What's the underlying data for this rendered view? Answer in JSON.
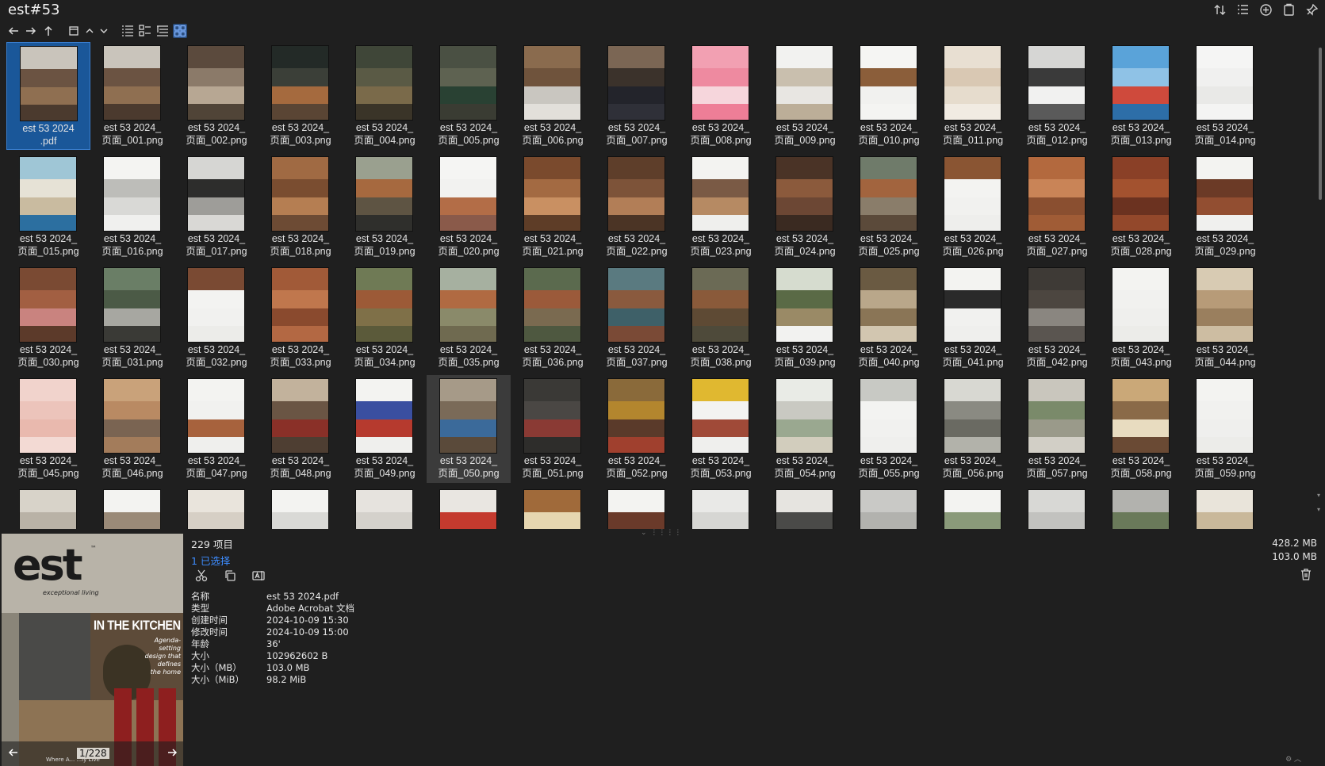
{
  "window": {
    "title": "est#53"
  },
  "toolbar": {
    "back": "back-arrow-icon",
    "forward": "forward-arrow-icon",
    "up": "up-arrow-icon",
    "view_modes": [
      "details-view-icon",
      "list-view-icon",
      "tree-view-icon",
      "grid-view-icon"
    ]
  },
  "files": [
    {
      "name": "est 53 2024\n.pdf",
      "colors": [
        "#c9c4bb",
        "#6b5342",
        "#8f6f51",
        "#4b3a2e"
      ]
    },
    {
      "name": "est 53 2024_\n页面_001.png",
      "colors": [
        "#c9c4bb",
        "#6b5342",
        "#8f6f51",
        "#4b3a2e"
      ]
    },
    {
      "name": "est 53 2024_\n页面_002.png",
      "colors": [
        "#5b4a3d",
        "#8b7a69",
        "#b7a793",
        "#504437"
      ]
    },
    {
      "name": "est 53 2024_\n页面_003.png",
      "colors": [
        "#232a27",
        "#3b3f38",
        "#a56a3e",
        "#5a4534"
      ]
    },
    {
      "name": "est 53 2024_\n页面_004.png",
      "colors": [
        "#3f4638",
        "#5a5a45",
        "#7a6a4a",
        "#3a3428"
      ]
    },
    {
      "name": "est 53 2024_\n页面_005.png",
      "colors": [
        "#4a5043",
        "#5e6251",
        "#294133",
        "#3a3c33"
      ]
    },
    {
      "name": "est 53 2024_\n页面_006.png",
      "colors": [
        "#8a6b4e",
        "#6f533c",
        "#c9c6c0",
        "#e2dfda"
      ]
    },
    {
      "name": "est 53 2024_\n页面_007.png",
      "colors": [
        "#7b6654",
        "#3b322b",
        "#23242b",
        "#2f3038"
      ]
    },
    {
      "name": "est 53 2024_\n页面_008.png",
      "colors": [
        "#f2a0b2",
        "#ee8aa0",
        "#f6d6dc",
        "#ee7e97"
      ]
    },
    {
      "name": "est 53 2024_\n页面_009.png",
      "colors": [
        "#f2f2f0",
        "#c9bfae",
        "#e8e6e2",
        "#bcae98"
      ]
    },
    {
      "name": "est 53 2024_\n页面_010.png",
      "colors": [
        "#f5f5f3",
        "#8b5e3a",
        "#f1f1ef",
        "#f4f4f2"
      ]
    },
    {
      "name": "est 53 2024_\n页面_011.png",
      "colors": [
        "#e8dfd2",
        "#d9c8b3",
        "#e6dccd",
        "#f1ebe2"
      ]
    },
    {
      "name": "est 53 2024_\n页面_012.png",
      "colors": [
        "#d6d6d4",
        "#3a3a3a",
        "#f1f1f0",
        "#5a5a5a"
      ]
    },
    {
      "name": "est 53 2024_\n页面_013.png",
      "colors": [
        "#5aa3d9",
        "#8fc2e6",
        "#cf4a3c",
        "#2d6ea8"
      ]
    },
    {
      "name": "est 53 2024_\n页面_014.png",
      "colors": [
        "#f5f5f4",
        "#f0f0ef",
        "#e9e9e7",
        "#f4f4f3"
      ]
    },
    {
      "name": "est 53 2024_\n页面_015.png",
      "colors": [
        "#9fc6d6",
        "#e6e2d6",
        "#c9bba0",
        "#2c6fa0"
      ]
    },
    {
      "name": "est 53 2024_\n页面_016.png",
      "colors": [
        "#f4f4f2",
        "#bdbdb9",
        "#d9d9d6",
        "#f0f0ee"
      ]
    },
    {
      "name": "est 53 2024_\n页面_017.png",
      "colors": [
        "#d6d6d3",
        "#2d2d2c",
        "#9e9d99",
        "#d9d8d5"
      ]
    },
    {
      "name": "est 53 2024_\n页面_018.png",
      "colors": [
        "#a06a43",
        "#7a4d30",
        "#b57e52",
        "#6d4b34"
      ]
    },
    {
      "name": "est 53 2024_\n页面_019.png",
      "colors": [
        "#9aa08f",
        "#a6693f",
        "#5e5443",
        "#2f2f2c"
      ]
    },
    {
      "name": "est 53 2024_\n页面_020.png",
      "colors": [
        "#f5f5f3",
        "#f2f2f0",
        "#b36d47",
        "#8a5a4a"
      ]
    },
    {
      "name": "est 53 2024_\n页面_021.png",
      "colors": [
        "#7a4a2d",
        "#a36a42",
        "#c99062",
        "#5e3d27"
      ]
    },
    {
      "name": "est 53 2024_\n页面_022.png",
      "colors": [
        "#5e3e2a",
        "#7d5339",
        "#b27e57",
        "#4b3425"
      ]
    },
    {
      "name": "est 53 2024_\n页面_023.png",
      "colors": [
        "#f3f3f1",
        "#7a5a45",
        "#b68a63",
        "#efefed"
      ]
    },
    {
      "name": "est 53 2024_\n页面_024.png",
      "colors": [
        "#4a3326",
        "#8b5a3c",
        "#6c4734",
        "#3a2a21"
      ]
    },
    {
      "name": "est 53 2024_\n页面_025.png",
      "colors": [
        "#6f7b6a",
        "#a2643e",
        "#8a7d6a",
        "#5b4a3a"
      ]
    },
    {
      "name": "est 53 2024_\n页面_026.png",
      "colors": [
        "#8a5533",
        "#f3f3f1",
        "#f1f1ef",
        "#eeeeec"
      ]
    },
    {
      "name": "est 53 2024_\n页面_027.png",
      "colors": [
        "#b3693e",
        "#c98457",
        "#8a4f30",
        "#a05c36"
      ]
    },
    {
      "name": "est 53 2024_\n页面_028.png",
      "colors": [
        "#8a4027",
        "#a3522f",
        "#6b3220",
        "#93482b"
      ]
    },
    {
      "name": "est 53 2024_\n页面_029.png",
      "colors": [
        "#f3f3f1",
        "#6b3a26",
        "#924e31",
        "#f0f0ee"
      ]
    },
    {
      "name": "est 53 2024_\n页面_030.png",
      "colors": [
        "#7a4a33",
        "#a25f42",
        "#c9837f",
        "#5c3a2a"
      ]
    },
    {
      "name": "est 53 2024_\n页面_031.png",
      "colors": [
        "#6a7e66",
        "#4b5a46",
        "#a7a7a1",
        "#3a3a36"
      ]
    },
    {
      "name": "est 53 2024_\n页面_032.png",
      "colors": [
        "#7a4a33",
        "#f3f3f1",
        "#f1f1ef",
        "#ecece9"
      ]
    },
    {
      "name": "est 53 2024_\n页面_033.png",
      "colors": [
        "#a15a38",
        "#c0774d",
        "#8a4a2e",
        "#b36843"
      ]
    },
    {
      "name": "est 53 2024_\n页面_034.png",
      "colors": [
        "#6f7a55",
        "#9c5a37",
        "#7f7048",
        "#5b5a3a"
      ]
    },
    {
      "name": "est 53 2024_\n页面_035.png",
      "colors": [
        "#a6b0a0",
        "#b06a42",
        "#8a8a6a",
        "#6f6a50"
      ]
    },
    {
      "name": "est 53 2024_\n页面_036.png",
      "colors": [
        "#5b6a4e",
        "#9b5a3a",
        "#7a6a50",
        "#4e5840"
      ]
    },
    {
      "name": "est 53 2024_\n页面_037.png",
      "colors": [
        "#5a7a80",
        "#8a5a3e",
        "#3e6068",
        "#7a4a36"
      ]
    },
    {
      "name": "est 53 2024_\n页面_038.png",
      "colors": [
        "#6b6a55",
        "#8a5a3a",
        "#5e4a34",
        "#4e4a3a"
      ]
    },
    {
      "name": "est 53 2024_\n页面_039.png",
      "colors": [
        "#d6dccf",
        "#5a6a46",
        "#9a8a66",
        "#f2f2f0"
      ]
    },
    {
      "name": "est 53 2024_\n页面_040.png",
      "colors": [
        "#6a5a42",
        "#b9a78a",
        "#8a7556",
        "#d2c6b0"
      ]
    },
    {
      "name": "est 53 2024_\n页面_041.png",
      "colors": [
        "#f3f3f1",
        "#2a2a2a",
        "#f1f1ef",
        "#efefed"
      ]
    },
    {
      "name": "est 53 2024_\n页面_042.png",
      "colors": [
        "#3e3a36",
        "#4c4640",
        "#8a8680",
        "#5a5550"
      ]
    },
    {
      "name": "est 53 2024_\n页面_043.png",
      "colors": [
        "#f3f3f1",
        "#f1f1ef",
        "#efefed",
        "#ecece9"
      ]
    },
    {
      "name": "est 53 2024_\n页面_044.png",
      "colors": [
        "#d8cbb3",
        "#b79b78",
        "#9a7f5e",
        "#cdbda2"
      ]
    },
    {
      "name": "est 53 2024_\n页面_045.png",
      "colors": [
        "#f1d3cc",
        "#ecc4bb",
        "#e9b9ae",
        "#f3dad4"
      ]
    },
    {
      "name": "est 53 2024_\n页面_046.png",
      "colors": [
        "#c9a27a",
        "#b98a63",
        "#7a6452",
        "#a37c5b"
      ]
    },
    {
      "name": "est 53 2024_\n页面_047.png",
      "colors": [
        "#f3f3f1",
        "#f1f1ef",
        "#a7623d",
        "#efefed"
      ]
    },
    {
      "name": "est 53 2024_\n页面_048.png",
      "colors": [
        "#c2b29c",
        "#6a5544",
        "#8a3028",
        "#4e3e32"
      ]
    },
    {
      "name": "est 53 2024_\n页面_049.png",
      "colors": [
        "#f3f3f1",
        "#3a4fa0",
        "#b63a2e",
        "#efefed"
      ]
    },
    {
      "name": "est 53 2024_\n页面_050.png",
      "colors": [
        "#a69a88",
        "#7a6a58",
        "#3b6a9a",
        "#5a4a3a"
      ]
    },
    {
      "name": "est 53 2024_\n页面_051.png",
      "colors": [
        "#3a3936",
        "#4a4744",
        "#8a3a34",
        "#2e2d2b"
      ]
    },
    {
      "name": "est 53 2024_\n页面_052.png",
      "colors": [
        "#8a6a3a",
        "#b3862e",
        "#5a3a2a",
        "#a0402e"
      ]
    },
    {
      "name": "est 53 2024_\n页面_053.png",
      "colors": [
        "#e0b830",
        "#f3f3f1",
        "#a04a38",
        "#efefed"
      ]
    },
    {
      "name": "est 53 2024_\n页面_054.png",
      "colors": [
        "#e9ebe6",
        "#c9c9c2",
        "#9aa890",
        "#d2cdbd"
      ]
    },
    {
      "name": "est 53 2024_\n页面_055.png",
      "colors": [
        "#c8c9c4",
        "#f3f3f1",
        "#f1f1ef",
        "#efefed"
      ]
    },
    {
      "name": "est 53 2024_\n页面_056.png",
      "colors": [
        "#d8d8d2",
        "#8a8a82",
        "#6a6a62",
        "#b2b2aa"
      ]
    },
    {
      "name": "est 53 2024_\n页面_057.png",
      "colors": [
        "#c9c6bd",
        "#7a8a6a",
        "#9a9a8a",
        "#d2cfc6"
      ]
    },
    {
      "name": "est 53 2024_\n页面_058.png",
      "colors": [
        "#caa878",
        "#8a6a48",
        "#e8dcc0",
        "#6a4a34"
      ]
    },
    {
      "name": "est 53 2024_\n页面_059.png",
      "colors": [
        "#f3f3f1",
        "#f1f1ef",
        "#efefed",
        "#ecece9"
      ]
    },
    {
      "name": "",
      "colors": [
        "#d8d3c9",
        "#b9b2a6",
        "#cfc9be",
        "#a59e92"
      ]
    },
    {
      "name": "",
      "colors": [
        "#f3f3f1",
        "#9a8a78",
        "#efefed",
        "#ecece9"
      ]
    },
    {
      "name": "",
      "colors": [
        "#e9e4dc",
        "#d6cfc5",
        "#c9c2b8",
        "#e2dcd3"
      ]
    },
    {
      "name": "",
      "colors": [
        "#f3f3f1",
        "#d9d9d6",
        "#efefed",
        "#ecece9"
      ]
    },
    {
      "name": "",
      "colors": [
        "#e6e3de",
        "#d4d1cb",
        "#c96a3a",
        "#dedbd5"
      ]
    },
    {
      "name": "",
      "colors": [
        "#e9e6e1",
        "#c43a2e",
        "#d6d3ce",
        "#e1ded9"
      ]
    },
    {
      "name": "",
      "colors": [
        "#a06a3a",
        "#e6d6b0",
        "#8a5a30",
        "#c09a66"
      ]
    },
    {
      "name": "",
      "colors": [
        "#f3f3f1",
        "#6a3a2a",
        "#8a4a34",
        "#efefed"
      ]
    },
    {
      "name": "",
      "colors": [
        "#e9e9e7",
        "#d6d6d3",
        "#c9c9c6",
        "#e2e2df"
      ]
    },
    {
      "name": "",
      "colors": [
        "#e6e4e0",
        "#4a4a48",
        "#d3d1cd",
        "#dfddd9"
      ]
    },
    {
      "name": "",
      "colors": [
        "#c9c9c6",
        "#b2b2ae",
        "#a7a7a3",
        "#bdbdb9"
      ]
    },
    {
      "name": "",
      "colors": [
        "#f3f3f1",
        "#8a9a7a",
        "#efefed",
        "#ecece9"
      ]
    },
    {
      "name": "",
      "colors": [
        "#d8d8d5",
        "#c2c2bf",
        "#b5b5b2",
        "#cdcdca"
      ]
    },
    {
      "name": "",
      "colors": [
        "#b2b2ae",
        "#6a7a5a",
        "#9a9a96",
        "#a7a7a3"
      ]
    },
    {
      "name": "",
      "colors": [
        "#e9e4da",
        "#c9b89a",
        "#d6cdbd",
        "#e2dbcf"
      ]
    }
  ],
  "preview": {
    "logo": "est",
    "tm": "™",
    "tagline": "exceptional living",
    "headline": "IN THE KITCHEN",
    "subhead": "Agenda-setting\ndesign that\ndefines\nthe home",
    "bottom_text": "Where A...  ...ly Live",
    "page_counter": "1/228",
    "prev": "prev-page-icon",
    "next": "next-page-icon"
  },
  "info": {
    "item_count": "229 项目",
    "selected": "1 已选择",
    "actions": [
      "cut-icon",
      "copy-icon",
      "rename-icon"
    ],
    "properties": [
      {
        "key": "名称",
        "value": "est 53 2024.pdf"
      },
      {
        "key": "类型",
        "value": "Adobe Acrobat 文档"
      },
      {
        "key": "创建时间",
        "value": "2024-10-09  15:30"
      },
      {
        "key": "修改时间",
        "value": "2024-10-09  15:00"
      },
      {
        "key": "年龄",
        "value": "36'"
      },
      {
        "key": "大小",
        "value": "102962602 B"
      },
      {
        "key": "大小（MB）",
        "value": "103.0 MB"
      },
      {
        "key": "大小（MiB）",
        "value": "98.2 MiB"
      }
    ],
    "total_size": "428.2 MB",
    "selected_size": "103.0 MB"
  }
}
